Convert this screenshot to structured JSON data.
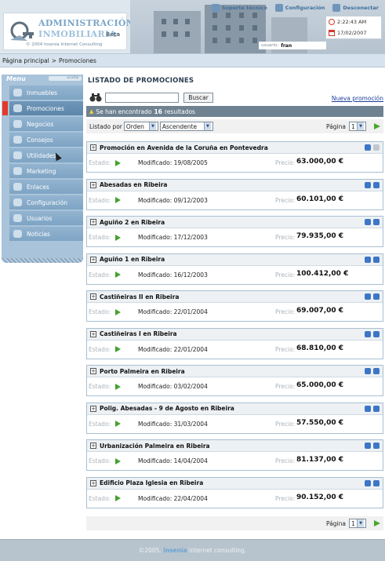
{
  "header": {
    "logo_line1": "ADMINISTRACIÓN",
    "logo_line2": "INMOBILIARIA",
    "logo_beta": "Beta",
    "logo_copyright": "© 2004 Insenia Internet Consulting",
    "links": [
      {
        "label": "Soporte técnico",
        "icon": "support-icon"
      },
      {
        "label": "Configuración",
        "icon": "settings-icon"
      },
      {
        "label": "Desconectar",
        "icon": "logout-icon"
      }
    ],
    "time": "2:22:43 AM",
    "date": "17/02/2007",
    "user_label": "usuario:",
    "user_name": "fran"
  },
  "breadcrumb": {
    "home": "Página principal",
    "separator": ">",
    "current": "Promociones"
  },
  "sidebar": {
    "title": "Menu",
    "toggle_label": "ocultar",
    "items": [
      {
        "label": "Inmuebles",
        "icon": "house-icon",
        "active": false
      },
      {
        "label": "Promociones",
        "icon": "promotion-icon",
        "active": true
      },
      {
        "label": "Negocios",
        "icon": "business-icon",
        "active": false
      },
      {
        "label": "Consejos",
        "icon": "tips-icon",
        "active": false
      },
      {
        "label": "Utilidades",
        "icon": "tools-icon",
        "active": false
      },
      {
        "label": "Marketing",
        "icon": "marketing-icon",
        "active": false
      },
      {
        "label": "Enlaces",
        "icon": "links-icon",
        "active": false
      },
      {
        "label": "Configuración",
        "icon": "gear-icon",
        "active": false
      },
      {
        "label": "Usuarios",
        "icon": "users-icon",
        "active": false
      },
      {
        "label": "Noticias",
        "icon": "news-icon",
        "active": false
      }
    ]
  },
  "main": {
    "title": "LISTADO DE PROMOCIONES",
    "search_value": "",
    "search_button": "Buscar",
    "new_link": "Nueva promoción",
    "result_prefix": "Se han encontrado",
    "result_count": "16",
    "result_suffix": "resultados",
    "sort_label": "Listado por",
    "sort_field": "Orden",
    "sort_direction": "Ascendente",
    "page_label": "Página",
    "page_value": "1",
    "estado_label": "Estado:",
    "modified_label": "Modificado:",
    "price_label": "Precio:",
    "promotions": [
      {
        "title": "Promoción en Avenida de la Coruña en Pontevedra",
        "modified": "19/08/2005",
        "price": "63.000,00 €",
        "up_enabled": false
      },
      {
        "title": "Abesadas en Ribeira",
        "modified": "09/12/2003",
        "price": "60.101,00 €",
        "up_enabled": true
      },
      {
        "title": "Aguiño 2 en Ribeira",
        "modified": "17/12/2003",
        "price": "79.935,00 €",
        "up_enabled": true
      },
      {
        "title": "Aguiño 1 en Ribeira",
        "modified": "16/12/2003",
        "price": "100.412,00 €",
        "up_enabled": true
      },
      {
        "title": "Castiñeiras II en Ribeira",
        "modified": "22/01/2004",
        "price": "69.007,00 €",
        "up_enabled": true
      },
      {
        "title": "Castiñeiras I en Ribeira",
        "modified": "22/01/2004",
        "price": "68.810,00 €",
        "up_enabled": true
      },
      {
        "title": "Porto Palmeira en Ribeira",
        "modified": "03/02/2004",
        "price": "65.000,00 €",
        "up_enabled": true
      },
      {
        "title": "Polig. Abesadas - 9 de Agosto en Ribeira",
        "modified": "31/03/2004",
        "price": "57.550,00 €",
        "up_enabled": true
      },
      {
        "title": "Urbanización Palmeira en Ribeira",
        "modified": "14/04/2004",
        "price": "81.137,00 €",
        "up_enabled": true
      },
      {
        "title": "Edificio Plaza Iglesia en Ribeira",
        "modified": "22/04/2004",
        "price": "90.152,00 €",
        "up_enabled": true
      }
    ]
  },
  "footer": {
    "year": "©2005.",
    "brand": "insenia",
    "text": "internet consulting."
  }
}
